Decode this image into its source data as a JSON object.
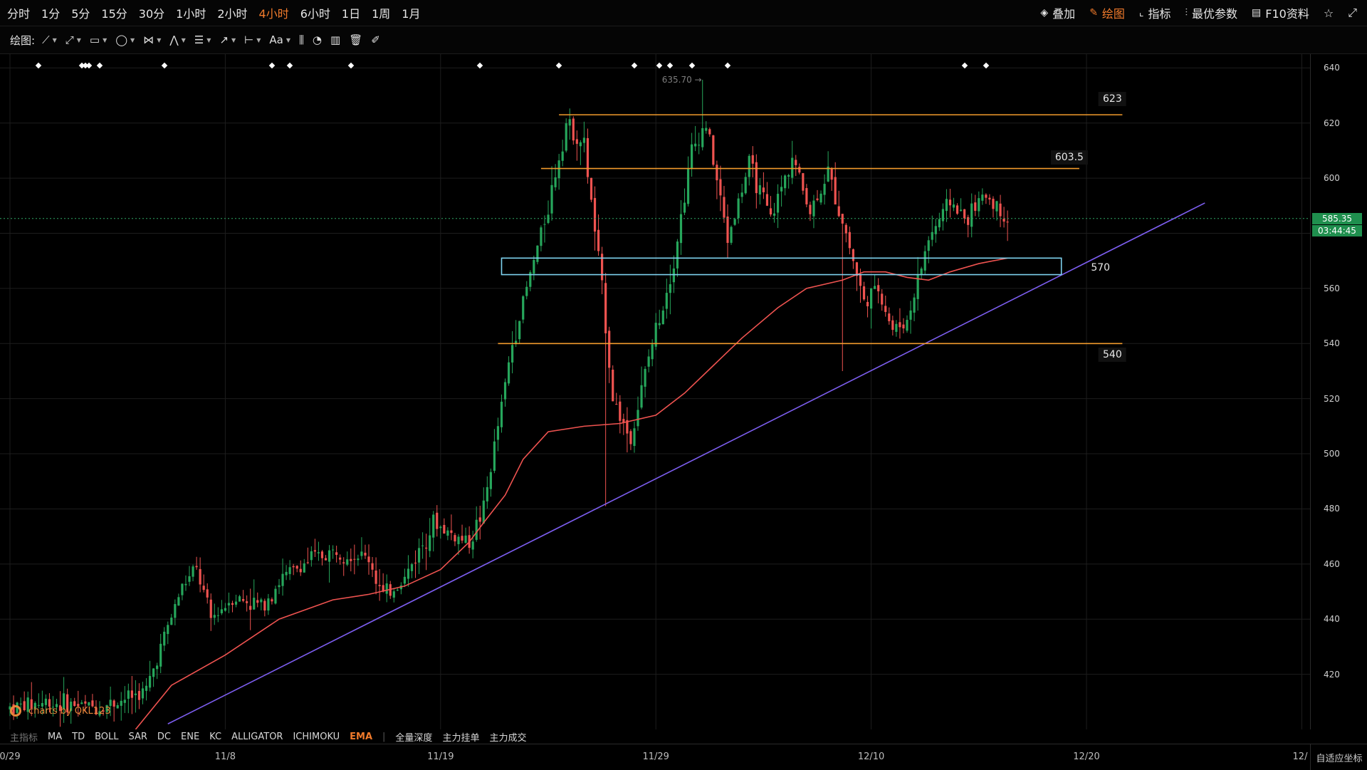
{
  "toolbar": {
    "intervals": [
      "分时",
      "1分",
      "5分",
      "15分",
      "30分",
      "1小时",
      "2小时",
      "4小时",
      "6小时",
      "1日",
      "1周",
      "1月"
    ],
    "active_interval": "4小时",
    "right_buttons": [
      {
        "label": "叠加",
        "icon": "layers-icon"
      },
      {
        "label": "绘图",
        "icon": "pencil-icon",
        "active": true
      },
      {
        "label": "指标",
        "icon": "chart-icon"
      },
      {
        "label": "最优参数",
        "icon": "sliders-icon"
      },
      {
        "label": "F10资料",
        "icon": "document-icon"
      }
    ],
    "drawing_label": "绘图:",
    "drawing_tools": [
      "line-tool-icon",
      "ray-tool-icon",
      "rectangle-tool-icon",
      "ellipse-tool-icon",
      "pattern-tool-icon",
      "shape-tool-icon",
      "fib-tool-icon",
      "arrow-tool-icon",
      "measure-tool-icon",
      "text-tool-icon",
      "candle-tool-icon",
      "snapshot-tool-icon",
      "stats-tool-icon",
      "delete-tool-icon",
      "brush-tool-icon"
    ],
    "text_tool_label": "Aa",
    "accent": "#f07a2b"
  },
  "indicators": {
    "items": [
      "主指标",
      "MA",
      "TD",
      "BOLL",
      "SAR",
      "DC",
      "ENE",
      "KC",
      "ALLIGATOR",
      "ICHIMOKU",
      "EMA"
    ],
    "active": "EMA",
    "extra": [
      "全量深度",
      "主力挂单",
      "主力成交"
    ]
  },
  "watermark": "charts by QKL123",
  "adapt_axis_label": "自适应坐标",
  "chart_data": {
    "type": "candlestick",
    "interval": "4小时",
    "ylim": [
      400,
      645
    ],
    "y_ticks": [
      420,
      440,
      460,
      480,
      500,
      520,
      540,
      560,
      580,
      600,
      620,
      640
    ],
    "x_labels": [
      {
        "label": "0/29",
        "bar": 0
      },
      {
        "label": "11/8",
        "bar": 60
      },
      {
        "label": "11/19",
        "bar": 120
      },
      {
        "label": "11/29",
        "bar": 180
      },
      {
        "label": "12/10",
        "bar": 240
      },
      {
        "label": "12/20",
        "bar": 300
      },
      {
        "label": "12/",
        "bar": 360
      }
    ],
    "last_bar_index": 278,
    "current_price": "585.35",
    "countdown": "03:44:45",
    "high_marker": {
      "label": "635.70 →",
      "value": 635.7,
      "bar": 193
    },
    "up_color": "#26a65b",
    "down_color": "#ef5350",
    "keypoints": [
      [
        0,
        408
      ],
      [
        10,
        410
      ],
      [
        25,
        408
      ],
      [
        38,
        414
      ],
      [
        42,
        430
      ],
      [
        48,
        452
      ],
      [
        52,
        458
      ],
      [
        56,
        440
      ],
      [
        62,
        448
      ],
      [
        70,
        445
      ],
      [
        76,
        455
      ],
      [
        84,
        462
      ],
      [
        92,
        465
      ],
      [
        100,
        462
      ],
      [
        104,
        448
      ],
      [
        110,
        455
      ],
      [
        118,
        475
      ],
      [
        124,
        470
      ],
      [
        128,
        468
      ],
      [
        132,
        480
      ],
      [
        136,
        510
      ],
      [
        140,
        540
      ],
      [
        145,
        565
      ],
      [
        150,
        590
      ],
      [
        155,
        620
      ],
      [
        160,
        612
      ],
      [
        165,
        560
      ],
      [
        168,
        520
      ],
      [
        173,
        505
      ],
      [
        178,
        535
      ],
      [
        185,
        570
      ],
      [
        190,
        610
      ],
      [
        194,
        620
      ],
      [
        200,
        578
      ],
      [
        206,
        605
      ],
      [
        212,
        585
      ],
      [
        218,
        608
      ],
      [
        223,
        588
      ],
      [
        228,
        602
      ],
      [
        233,
        580
      ],
      [
        238,
        555
      ],
      [
        242,
        560
      ],
      [
        246,
        545
      ],
      [
        250,
        548
      ],
      [
        256,
        578
      ],
      [
        262,
        592
      ],
      [
        266,
        585
      ],
      [
        272,
        594
      ],
      [
        278,
        585
      ]
    ],
    "ema": [
      [
        35,
        400
      ],
      [
        45,
        416
      ],
      [
        60,
        427
      ],
      [
        75,
        440
      ],
      [
        90,
        447
      ],
      [
        100,
        449
      ],
      [
        110,
        452
      ],
      [
        120,
        458
      ],
      [
        128,
        468
      ],
      [
        132,
        475
      ],
      [
        138,
        485
      ],
      [
        143,
        498
      ],
      [
        150,
        508
      ],
      [
        160,
        510
      ],
      [
        170,
        511
      ],
      [
        180,
        514
      ],
      [
        188,
        522
      ],
      [
        196,
        532
      ],
      [
        204,
        542
      ],
      [
        214,
        553
      ],
      [
        222,
        560
      ],
      [
        232,
        563
      ],
      [
        238,
        566
      ],
      [
        244,
        566
      ],
      [
        250,
        564
      ],
      [
        256,
        563
      ],
      [
        262,
        566
      ],
      [
        270,
        569
      ],
      [
        278,
        571
      ]
    ],
    "trendline": {
      "from": [
        44,
        402
      ],
      "to": [
        333,
        591
      ],
      "color": "#7d5ef0"
    },
    "resistance_lines": [
      {
        "label": "623",
        "value": 623,
        "from_bar": 153,
        "to_bar": 310
      },
      {
        "label": "603.5",
        "value": 603.5,
        "from_bar": 148,
        "to_bar": 298
      },
      {
        "label": "540",
        "value": 540,
        "from_bar": 136,
        "to_bar": 310
      }
    ],
    "zone": {
      "label": "570",
      "low": 565,
      "high": 571,
      "from_bar": 137,
      "to_bar": 293
    },
    "event_markers": [
      8,
      20,
      21,
      22,
      25,
      43,
      73,
      78,
      95,
      131,
      153,
      174,
      181,
      184,
      190,
      200,
      266,
      272
    ]
  }
}
